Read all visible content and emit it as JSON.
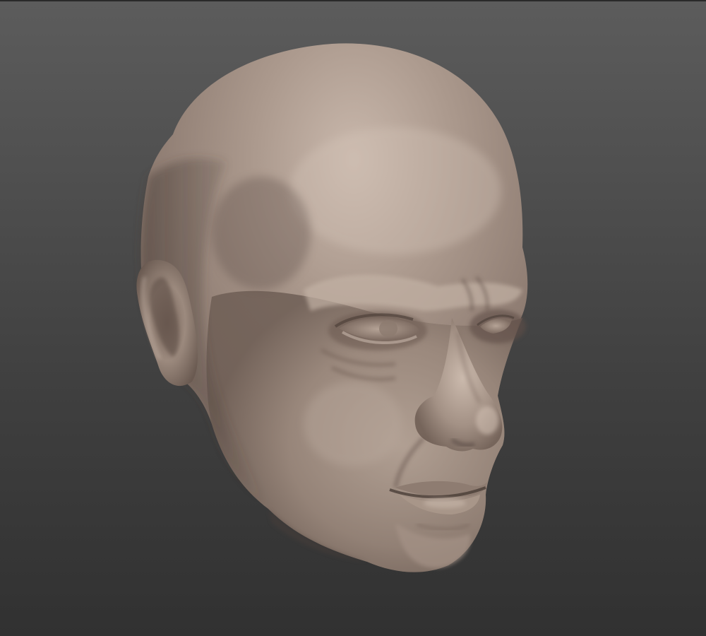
{
  "scene": {
    "subject": "head-sculpt",
    "material_color": "#9c8b80",
    "highlight_color": "#cdbdb1",
    "shadow_color": "#4e413b",
    "background_top": "#5c5c5c",
    "background_bottom": "#313131"
  }
}
